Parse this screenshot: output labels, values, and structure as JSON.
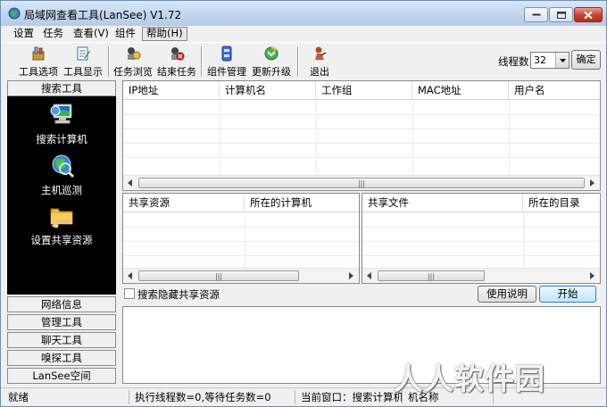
{
  "window": {
    "title": "局域网查看工具(LanSee) V1.72"
  },
  "menu": [
    {
      "label": "设置"
    },
    {
      "label": "任务"
    },
    {
      "label": "查看(V)"
    },
    {
      "label": "组件"
    },
    {
      "label": "帮助(H)"
    }
  ],
  "toolbar": {
    "tool_options": "工具选项",
    "tool_display": "工具显示",
    "task_browse": "任务浏览",
    "end_task": "结束任务",
    "plugin_manage": "组件管理",
    "update": "更新升级",
    "exit": "退出",
    "threads_label": "线程数",
    "threads_value": "32",
    "confirm": "确定"
  },
  "left_panel": {
    "header": "搜索工具",
    "items": [
      {
        "label": "搜索计算机",
        "icon": "computer-icon"
      },
      {
        "label": "主机巡测",
        "icon": "globe-icon"
      },
      {
        "label": "设置共享资源",
        "icon": "shared-folder-icon"
      }
    ],
    "bottom_tabs": [
      {
        "label": "网络信息"
      },
      {
        "label": "管理工具"
      },
      {
        "label": "聊天工具"
      },
      {
        "label": "嗅探工具"
      },
      {
        "label": "LanSee空间"
      }
    ]
  },
  "host_table": {
    "columns": [
      "IP地址",
      "计算机名",
      "工作组",
      "MAC地址",
      "用户名"
    ]
  },
  "share_table": {
    "columns": [
      "共享资源",
      "所在的计算机"
    ]
  },
  "file_table": {
    "columns": [
      "共享文件",
      "所在的目录"
    ]
  },
  "search_hidden": "搜索隐藏共享资源",
  "help_button": "使用说明",
  "start_button": "开始",
  "status": {
    "state": "就绪",
    "threads": "执行线程数=0,等待任务数=0",
    "current": "当前窗口：搜索计算机",
    "extra": "机名称"
  },
  "watermark": "人人软件园",
  "colors": {
    "accent": "#3c7fb1",
    "left_panel_bg": "#000000"
  }
}
